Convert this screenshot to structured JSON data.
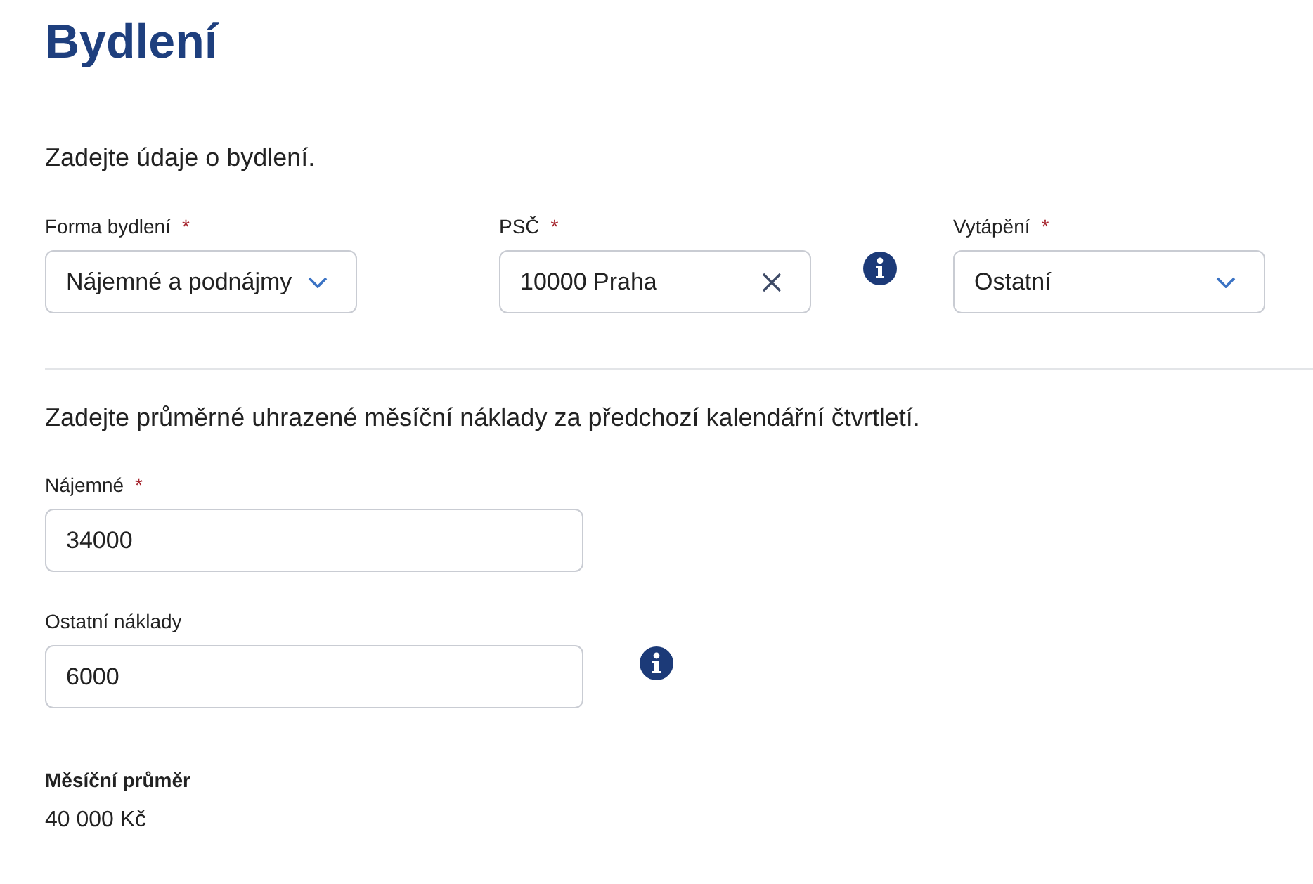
{
  "title": "Bydlení",
  "intro": "Zadejte údaje o bydlení.",
  "housing_fields": [
    {
      "kind": "select",
      "label": "Forma bydlení",
      "required_mark": "*",
      "value": "Nájemné a podnájmy",
      "info": false
    },
    {
      "kind": "clearable",
      "label": "PSČ",
      "required_mark": "*",
      "value": "10000 Praha",
      "info": true
    },
    {
      "kind": "select",
      "label": "Vytápění",
      "required_mark": "*",
      "value": "Ostatní",
      "info": false
    }
  ],
  "costs_intro": "Zadejte průměrné uhrazené měsíční náklady za předchozí kalendářní čtvrtletí.",
  "cost_fields": [
    {
      "kind": "text",
      "label": "Nájemné",
      "required_mark": "*",
      "value": "34000",
      "info": false
    },
    {
      "kind": "text",
      "label": "Ostatní náklady",
      "value": "6000",
      "info": true
    }
  ],
  "summary": {
    "label": "Měsíční průměr",
    "value": "40 000 Kč"
  }
}
